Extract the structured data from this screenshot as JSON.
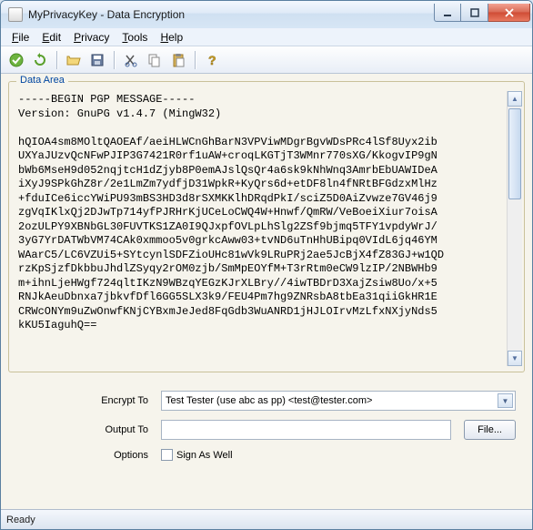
{
  "window": {
    "title": "MyPrivacyKey - Data Encryption"
  },
  "menu": {
    "file": "File",
    "edit": "Edit",
    "privacy": "Privacy",
    "tools": "Tools",
    "help": "Help"
  },
  "dataArea": {
    "legend": "Data Area",
    "content": "-----BEGIN PGP MESSAGE-----\nVersion: GnuPG v1.4.7 (MingW32)\n\nhQIOA4sm8MOltQAOEAf/aeiHLWCnGhBarN3VPViwMDgrBgvWDsPRc4lSf8Uyx2ib\nUXYaJUzvQcNFwPJIP3G7421R0rf1uAW+croqLKGTjT3WMnr770sXG/KkogvIP9gN\nbWb6MseH9d052nqjtcH1dZjyb8P0emAJslQsQr4a6sk9kNhWnq3AmrbEbUAWIDeA\niXyJ9SPkGhZ8r/2e1LmZm7ydfjD31WpkR+KyQrs6d+etDF8ln4fNRtBFGdzxMlHz\n+fduICe6iccYWiPU93mBS3HD3d8rSXMKKlhDRqdPkI/sciZ5D0AiZvwze7GV46j9\nzgVqIKlxQj2DJwTp714yfPJRHrKjUCeLoCWQ4W+Hnwf/QmRW/VeBoeiXiur7oisA\n2ozULPY9XBNbGL30FUVTKS1ZA0I9QJxpfOVLpLhSlg2ZSf9bjmq5TFY1vpdyWrJ/\n3yG7YrDATWbVM74CAk0xmmoo5v0grkcAww03+tvND6uTnHhUBipq0VIdL6jq46YM\nWAarC5/LC6VZUi5+SYtcynlSDFZioUHc81wVk9LRuPRj2ae5JcBjX4fZ83GJ+w1QD\nrzKpSjzfDkbbuJhdlZSyqy2rOM0zjb/SmMpEOYfM+T3rRtm0eCW9lzIP/2NBWHb9\nm+ihnLjeHWgf724qltIKzN9WBzqYEGzKJrXLBry//4iwTBDrD3XajZsiw8Uo/x+5\nRNJkAeuDbnxa7jbkvfDfl6GG5SLX3k9/FEU4Pm7hg9ZNRsbA8tbEa31qiiGkHR1E\nCRWcONYm9uZwOnwfKNjCYBxmJeJed8FqGdb3WuANRD1jHJLOIrvMzLfxNXjyNds5\nkKU5IaguhQ==\n"
  },
  "form": {
    "encryptToLabel": "Encrypt To",
    "encryptToValue": "Test Tester (use abc as pp) <test@tester.com>",
    "outputToLabel": "Output To",
    "outputToValue": "",
    "fileButton": "File...",
    "optionsLabel": "Options",
    "signAsWellLabel": "Sign As Well"
  },
  "status": {
    "text": "Ready"
  }
}
